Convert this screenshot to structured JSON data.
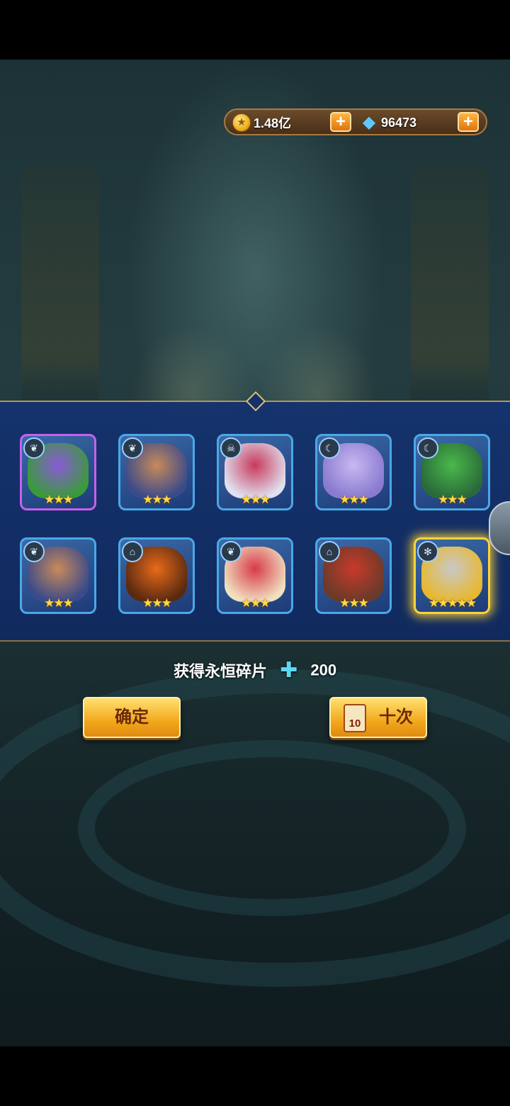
{
  "currency": {
    "gold": {
      "icon": "gold-coin-icon",
      "value": "1.48亿"
    },
    "gems": {
      "icon": "diamond-icon",
      "value": "96473"
    },
    "plus_label": "+"
  },
  "heroes": [
    {
      "faction": "nature",
      "badge": "❦",
      "stars": "★★★",
      "rarity": "purple",
      "palette": [
        "#8a5ad8",
        "#3a9a3a"
      ]
    },
    {
      "faction": "nature",
      "badge": "❦",
      "stars": "★★★",
      "rarity": "blue",
      "palette": [
        "#c88a5a",
        "#3a4a8a"
      ]
    },
    {
      "faction": "shadow",
      "badge": "☠",
      "stars": "★★★",
      "rarity": "blue",
      "palette": [
        "#c83a5a",
        "#e0e0f0"
      ]
    },
    {
      "faction": "shadow",
      "badge": "☾",
      "stars": "★★★",
      "rarity": "blue",
      "palette": [
        "#c8b8f0",
        "#8a7ad0"
      ]
    },
    {
      "faction": "shadow",
      "badge": "☾",
      "stars": "★★★",
      "rarity": "blue",
      "palette": [
        "#4ab84a",
        "#2a6a3a"
      ]
    },
    {
      "faction": "nature",
      "badge": "❦",
      "stars": "★★★",
      "rarity": "blue",
      "palette": [
        "#c88a5a",
        "#3a4a8a"
      ]
    },
    {
      "faction": "fortress",
      "badge": "⌂",
      "stars": "★★★",
      "rarity": "blue",
      "palette": [
        "#e86a1a",
        "#5a2a10"
      ]
    },
    {
      "faction": "nature",
      "badge": "❦",
      "stars": "★★★",
      "rarity": "blue",
      "palette": [
        "#d83a4a",
        "#f0e0c0"
      ]
    },
    {
      "faction": "fortress",
      "badge": "⌂",
      "stars": "★★★",
      "rarity": "blue",
      "palette": [
        "#c83a2a",
        "#6a3a2a"
      ]
    },
    {
      "faction": "light",
      "badge": "✻",
      "stars": "★★★★★",
      "rarity": "gold",
      "palette": [
        "#c8c8c8",
        "#e8b830"
      ]
    }
  ],
  "reward": {
    "label": "获得永恒碎片",
    "icon": "puzzle-piece-icon",
    "amount": "200"
  },
  "buttons": {
    "confirm": "确定",
    "ten_times": "十次",
    "ten_badge": "10"
  }
}
